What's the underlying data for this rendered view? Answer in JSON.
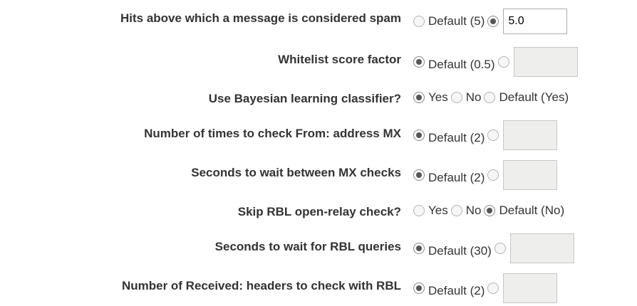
{
  "rows": [
    {
      "label": "Hits above which a message is considered spam",
      "options": [
        {
          "text": "Default (5)",
          "checked": false
        },
        {
          "text": "",
          "checked": true
        }
      ],
      "field_value": "5.0"
    },
    {
      "label": "Whitelist score factor",
      "options": [
        {
          "text": "Default (0.5)",
          "checked": true
        },
        {
          "text": "",
          "checked": false
        }
      ],
      "field_value": ""
    },
    {
      "label": "Use Bayesian learning classifier?",
      "options": [
        {
          "text": "Yes",
          "checked": true
        },
        {
          "text": "No",
          "checked": false
        },
        {
          "text": "Default (Yes)",
          "checked": false
        }
      ]
    },
    {
      "label": "Number of times to check From: address MX",
      "options": [
        {
          "text": "Default (2)",
          "checked": true
        },
        {
          "text": "",
          "checked": false
        }
      ],
      "field_value": ""
    },
    {
      "label": "Seconds to wait between MX checks",
      "options": [
        {
          "text": "Default (2)",
          "checked": true
        },
        {
          "text": "",
          "checked": false
        }
      ],
      "field_value": ""
    },
    {
      "label": "Skip RBL open-relay check?",
      "options": [
        {
          "text": "Yes",
          "checked": false
        },
        {
          "text": "No",
          "checked": false
        },
        {
          "text": "Default (No)",
          "checked": true
        }
      ]
    },
    {
      "label": "Seconds to wait for RBL queries",
      "options": [
        {
          "text": "Default (30)",
          "checked": true
        },
        {
          "text": "",
          "checked": false
        }
      ],
      "field_value": ""
    },
    {
      "label": "Number of Received: headers to check with RBL",
      "options": [
        {
          "text": "Default (2)",
          "checked": true
        },
        {
          "text": "",
          "checked": false
        }
      ],
      "field_value": ""
    }
  ]
}
